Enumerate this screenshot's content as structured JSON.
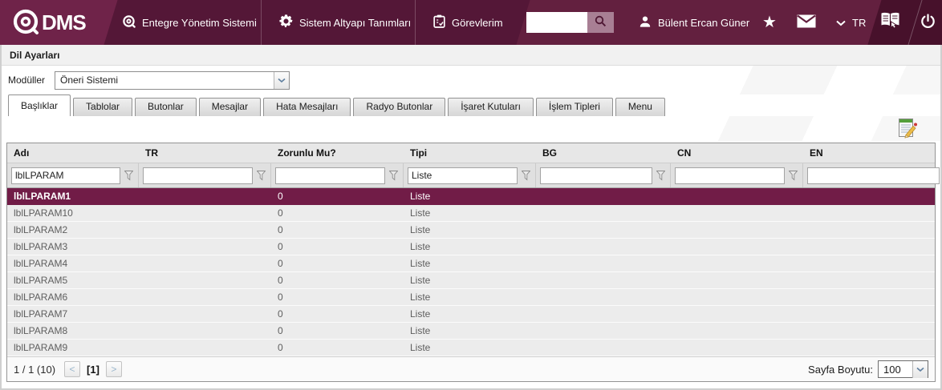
{
  "topbar": {
    "logo_text": "DMS",
    "menu_items": [
      {
        "label": "Entegre Yönetim Sistemi"
      },
      {
        "label": "Sistem Altyapı Tanımları"
      },
      {
        "label": "Görevlerim"
      }
    ],
    "search_value": "",
    "user_name": "Bülent Ercan Güner",
    "language": "TR"
  },
  "page": {
    "title": "Dil Ayarları"
  },
  "module_selector": {
    "label": "Modüller",
    "value": "Öneri Sistemi"
  },
  "tabs": [
    {
      "label": "Başlıklar",
      "active": true
    },
    {
      "label": "Tablolar"
    },
    {
      "label": "Butonlar"
    },
    {
      "label": "Mesajlar"
    },
    {
      "label": "Hata Mesajları"
    },
    {
      "label": "Radyo Butonlar"
    },
    {
      "label": "İşaret Kutuları"
    },
    {
      "label": "İşlem Tipleri"
    },
    {
      "label": "Menu"
    }
  ],
  "table": {
    "columns": [
      {
        "label": "Adı",
        "filter": "lblLPARAM"
      },
      {
        "label": "TR",
        "filter": ""
      },
      {
        "label": "Zorunlu Mu?",
        "filter": ""
      },
      {
        "label": "Tipi",
        "filter": "Liste"
      },
      {
        "label": "BG",
        "filter": ""
      },
      {
        "label": "CN",
        "filter": ""
      },
      {
        "label": "EN",
        "filter": ""
      }
    ],
    "rows": [
      {
        "selected": true,
        "cells": [
          "lblLPARAM1",
          "",
          "0",
          "Liste",
          "",
          "",
          ""
        ]
      },
      {
        "selected": false,
        "cells": [
          "lblLPARAM10",
          "",
          "0",
          "Liste",
          "",
          "",
          ""
        ]
      },
      {
        "selected": false,
        "cells": [
          "lblLPARAM2",
          "",
          "0",
          "Liste",
          "",
          "",
          ""
        ]
      },
      {
        "selected": false,
        "cells": [
          "lblLPARAM3",
          "",
          "0",
          "Liste",
          "",
          "",
          ""
        ]
      },
      {
        "selected": false,
        "cells": [
          "lblLPARAM4",
          "",
          "0",
          "Liste",
          "",
          "",
          ""
        ]
      },
      {
        "selected": false,
        "cells": [
          "lblLPARAM5",
          "",
          "0",
          "Liste",
          "",
          "",
          ""
        ]
      },
      {
        "selected": false,
        "cells": [
          "lblLPARAM6",
          "",
          "0",
          "Liste",
          "",
          "",
          ""
        ]
      },
      {
        "selected": false,
        "cells": [
          "lblLPARAM7",
          "",
          "0",
          "Liste",
          "",
          "",
          ""
        ]
      },
      {
        "selected": false,
        "cells": [
          "lblLPARAM8",
          "",
          "0",
          "Liste",
          "",
          "",
          ""
        ]
      },
      {
        "selected": false,
        "cells": [
          "lblLPARAM9",
          "",
          "0",
          "Liste",
          "",
          "",
          ""
        ]
      }
    ]
  },
  "pagination": {
    "summary": "1 / 1 (10)",
    "prev": "<",
    "current": "[1]",
    "next": ">"
  },
  "page_size": {
    "label": "Sayfa Boyutu:",
    "value": "100"
  },
  "colors": {
    "topbar": "#541737",
    "topbar_light": "#6f2349",
    "topbar_dark": "#47112b",
    "selected_row": "#711c47",
    "search_button": "#a87f94"
  }
}
